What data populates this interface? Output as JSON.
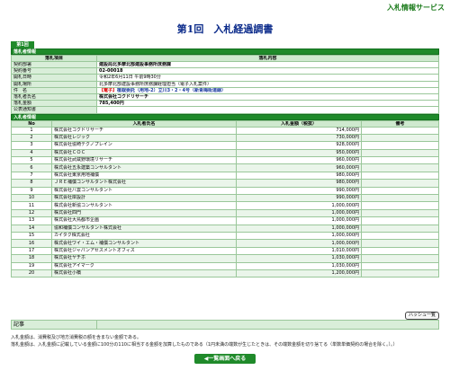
{
  "header": {
    "service": "入札情報サービス",
    "title": "第1回　入札経過調書"
  },
  "tab_label": "第1回",
  "winner_section": {
    "title": "落札者情報",
    "col_item": "落札項目",
    "col_content": "落札内容",
    "rows": [
      {
        "label": "契約部署",
        "value": "建設局北多摩北部建設事務所庶務課"
      },
      {
        "label": "契約番号",
        "value": "02-00018"
      },
      {
        "label": "開札日時",
        "value": "令和2年6月11日 午前9時30分"
      },
      {
        "label": "開札場所",
        "value": "北多摩北部建設事務所庶務課経理担当（電子入札案件）"
      },
      {
        "label": "件　名",
        "value_prefix": "【電子】",
        "value": "植栽委託（用地-2）立川3・2・4号（新青梅街道線）"
      },
      {
        "label": "落札者氏名",
        "value": "株式会社コクドリサーチ"
      },
      {
        "label": "落札金額",
        "value": "785,400円"
      },
      {
        "label": "公表通知書",
        "value": ""
      }
    ]
  },
  "bidders_section": {
    "title": "入札者情報",
    "col_no": "No",
    "col_name": "入札者氏名",
    "col_amount": "入札金額（税抜）",
    "col_note": "備考",
    "rows": [
      {
        "no": "1",
        "name": "株式会社コクドリサーチ",
        "amount": "714,000円",
        "note": ""
      },
      {
        "no": "2",
        "name": "株式会社レジック",
        "amount": "730,000円",
        "note": ""
      },
      {
        "no": "3",
        "name": "株式会社協崎テクノプレイン",
        "amount": "928,000円",
        "note": ""
      },
      {
        "no": "4",
        "name": "株式会社ＣＯＣ",
        "amount": "950,000円",
        "note": ""
      },
      {
        "no": "5",
        "name": "株式会社武蔵野環境リサーチ",
        "amount": "960,000円",
        "note": ""
      },
      {
        "no": "6",
        "name": "株式会社五永建築コンサルタント",
        "amount": "960,000円",
        "note": ""
      },
      {
        "no": "7",
        "name": "株式会社東京用地補償",
        "amount": "980,000円",
        "note": ""
      },
      {
        "no": "8",
        "name": "ＪＲＥ補償コンサルタント株式会社",
        "amount": "980,000円",
        "note": ""
      },
      {
        "no": "9",
        "name": "株式会社八雲コンサルタント",
        "amount": "990,000円",
        "note": ""
      },
      {
        "no": "10",
        "name": "株式会社岸設計",
        "amount": "990,000円",
        "note": ""
      },
      {
        "no": "11",
        "name": "株式会社新協コンサルタント",
        "amount": "1,000,000円",
        "note": ""
      },
      {
        "no": "12",
        "name": "株式会社四門",
        "amount": "1,000,000円",
        "note": ""
      },
      {
        "no": "13",
        "name": "株式会社大鳥都市企画",
        "amount": "1,000,000円",
        "note": ""
      },
      {
        "no": "14",
        "name": "協和補償コンサルタント株式会社",
        "amount": "1,000,000円",
        "note": ""
      },
      {
        "no": "15",
        "name": "カイタク株式会社",
        "amount": "1,000,000円",
        "note": ""
      },
      {
        "no": "16",
        "name": "株式会社ワイ・エム・補償コンサルタント",
        "amount": "1,000,000円",
        "note": ""
      },
      {
        "no": "17",
        "name": "株式会社ジャパンアセスメントオフィス",
        "amount": "1,010,000円",
        "note": ""
      },
      {
        "no": "18",
        "name": "株式会社ヤチホ",
        "amount": "1,030,000円",
        "note": ""
      },
      {
        "no": "19",
        "name": "株式会社アイマーク",
        "amount": "1,030,000円",
        "note": ""
      },
      {
        "no": "20",
        "name": "株式会社小橋",
        "amount": "1,200,000円",
        "note": ""
      }
    ]
  },
  "hyphen_list_button": "ハッシュ一覧",
  "kiji_label": "記事",
  "kiji_value": "",
  "notes": [
    "入札金額は、消費税及び地方消費税の額を含まない金額である。",
    "落札金額は、入札金額に記載している金額に100分の110に相当する金額を加算したものである（1円未満の端数が生じたときは、その端数金額を切り捨てる（単数単価契約の場合を除く。）。）"
  ],
  "back_button": "◀一覧画面へ戻る"
}
